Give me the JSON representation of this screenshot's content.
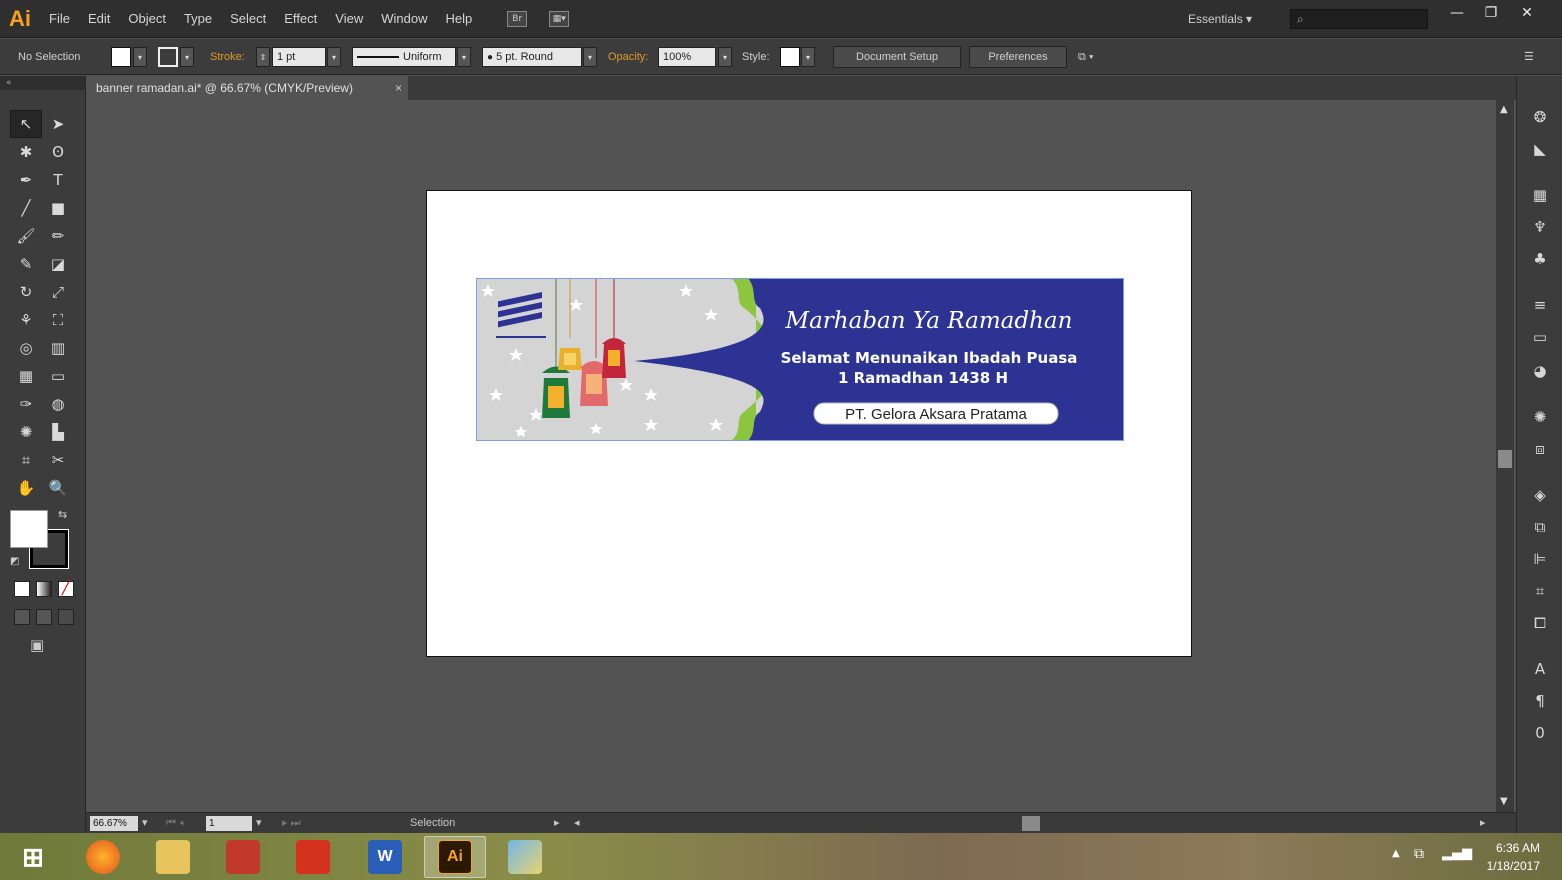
{
  "app": {
    "logo": "Ai"
  },
  "menu": [
    "File",
    "Edit",
    "Object",
    "Type",
    "Select",
    "Effect",
    "View",
    "Window",
    "Help"
  ],
  "header": {
    "workspace": "Essentials",
    "search_placeholder": ""
  },
  "control_bar": {
    "selection": "No Selection",
    "stroke_label": "Stroke:",
    "stroke_weight": "1 pt",
    "profile": "Uniform",
    "brush": "5 pt. Round",
    "opacity_label": "Opacity:",
    "opacity_value": "100%",
    "style_label": "Style:",
    "document_setup": "Document Setup",
    "preferences": "Preferences"
  },
  "document": {
    "tab_title": "banner ramadan.ai* @ 66.67% (CMYK/Preview)",
    "close": "×"
  },
  "banner": {
    "heading": "Marhaban Ya Ramadhan",
    "line1": "Selamat Menunaikan Ibadah Puasa",
    "line2": "1 Ramadhan 1438 H",
    "company": "PT. Gelora Aksara Pratama",
    "colors": {
      "navy": "#2d3393",
      "lime": "#8cc63f",
      "star_bg": "#d4d4d4"
    }
  },
  "status_bar": {
    "zoom": "66.67%",
    "artboard": "1",
    "tool": "Selection"
  },
  "taskbar": {
    "apps": [
      {
        "name": "firefox",
        "label": ""
      },
      {
        "name": "file-explorer",
        "label": ""
      },
      {
        "name": "calculator",
        "label": ""
      },
      {
        "name": "acrobat",
        "label": ""
      },
      {
        "name": "word",
        "label": "W"
      },
      {
        "name": "illustrator",
        "label": "Ai"
      },
      {
        "name": "paint",
        "label": ""
      }
    ],
    "time": "6:36 AM",
    "date": "1/18/2017"
  }
}
